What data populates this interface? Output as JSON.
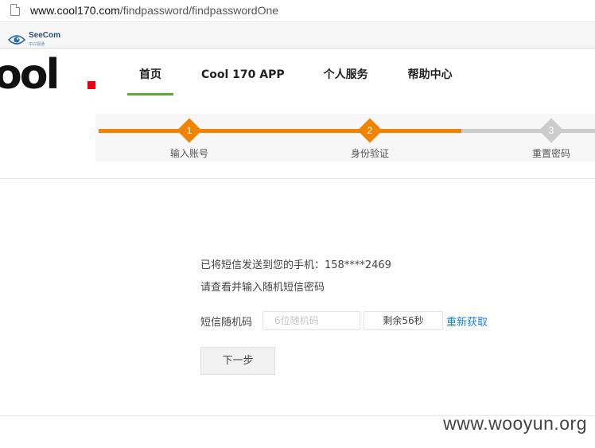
{
  "browser": {
    "url_domain": "www.cool170.com",
    "url_path": "/findpassword/findpasswordOne"
  },
  "bookmarks": {
    "seecom_name": "SeeCom",
    "seecom_sub": "中兴视通"
  },
  "header": {
    "logo_text": "ool",
    "nav": [
      {
        "label": "首页",
        "active": true
      },
      {
        "label": "Cool 170 APP",
        "active": false
      },
      {
        "label": "个人服务",
        "active": false
      },
      {
        "label": "帮助中心",
        "active": false
      }
    ],
    "accent_color": "#5aac2f",
    "logo_dot_color": "#e60012"
  },
  "steps": {
    "items": [
      {
        "number": "1",
        "label": "输入账号",
        "state": "done"
      },
      {
        "number": "2",
        "label": "身份验证",
        "state": "done"
      },
      {
        "number": "3",
        "label": "重置密码",
        "state": "todo"
      }
    ],
    "done_color": "#f08300",
    "todo_color": "#cccccc"
  },
  "form": {
    "sent_message": "已将短信发送到您的手机：158****2469",
    "instruction": "请查看并输入随机短信密码",
    "code_label": "短信随机码",
    "code_placeholder": "6位随机码",
    "code_value": "",
    "countdown": "剩余56秒",
    "resend_label": "重新获取",
    "next_label": "下一步"
  },
  "watermark": "www.wooyun.org"
}
